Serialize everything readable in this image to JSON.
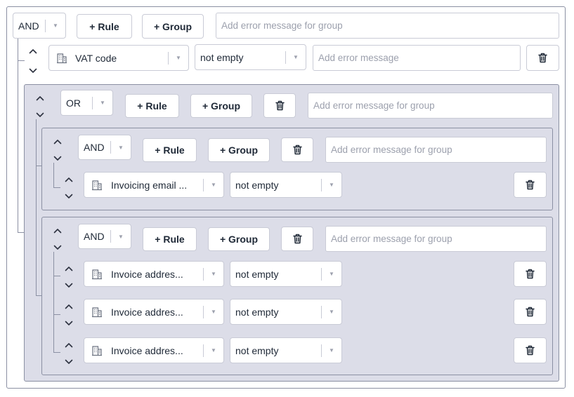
{
  "labels": {
    "add_rule": "+ Rule",
    "add_group": "+ Group",
    "group_error_placeholder": "Add error message for group",
    "rule_error_placeholder": "Add error message"
  },
  "root": {
    "combinator": "AND",
    "rule": {
      "field": "VAT code",
      "operator": "not empty"
    }
  },
  "group1": {
    "combinator": "OR"
  },
  "group2": {
    "combinator": "AND",
    "rule": {
      "field": "Invoicing email ...",
      "operator": "not empty"
    }
  },
  "group3": {
    "combinator": "AND",
    "rules": [
      {
        "field": "Invoice addres...",
        "operator": "not empty"
      },
      {
        "field": "Invoice addres...",
        "operator": "not empty"
      },
      {
        "field": "Invoice addres...",
        "operator": "not empty"
      }
    ]
  },
  "icons": {
    "field": "building-icon",
    "delete": "trash-icon",
    "move_up": "chevron-up-icon",
    "move_down": "chevron-down-icon",
    "dropdown": "caret-down-icon"
  },
  "colors": {
    "border": "#8b90a3",
    "nested_background": "#dcdde8",
    "control_border": "#c9cbd6",
    "placeholder": "#9ca0ad"
  }
}
